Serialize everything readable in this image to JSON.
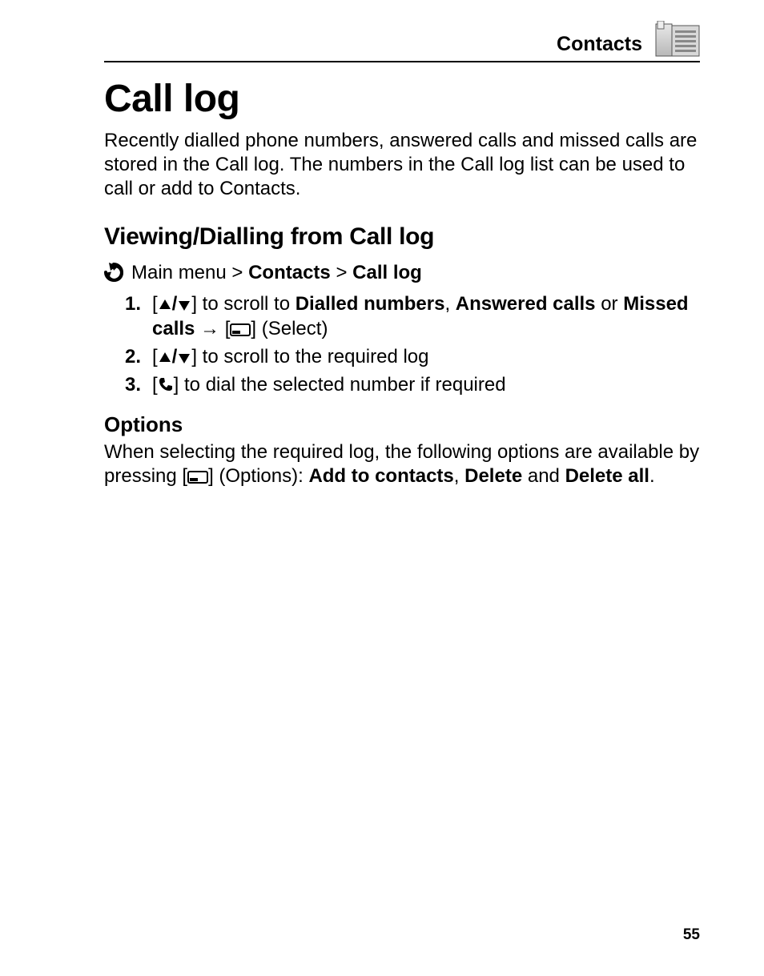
{
  "header": {
    "section": "Contacts"
  },
  "title": "Call log",
  "intro": "Recently dialled phone numbers, answered calls and missed calls are stored in the Call log. The numbers in the Call log list can be used to call or add to Contacts.",
  "section_heading": "Viewing/Dialling from Call log",
  "breadcrumb": {
    "root": "Main menu",
    "sep1": ">",
    "l1": "Contacts",
    "sep2": ">",
    "l2": "Call log"
  },
  "steps": {
    "s1": {
      "num": "1.",
      "pre": "[",
      "mid": "] to scroll to ",
      "b1": "Dialled numbers",
      "c1": ", ",
      "b2": "Answered calls",
      "c2": " or ",
      "b3": "Missed calls",
      "arrow": " → [",
      "post": "] (Select)"
    },
    "s2": {
      "num": "2.",
      "pre": "[",
      "post": "] to scroll to the required log"
    },
    "s3": {
      "num": "3.",
      "pre": "[",
      "post": "] to dial the selected number if required"
    }
  },
  "options": {
    "heading": "Options",
    "pre": "When selecting the required log, the following options are available by pressing [",
    "mid": "] (Options): ",
    "b1": "Add to contacts",
    "c1": ", ",
    "b2": "Delete",
    "c2": " and ",
    "b3": "Delete all",
    "end": "."
  },
  "page_number": "55"
}
